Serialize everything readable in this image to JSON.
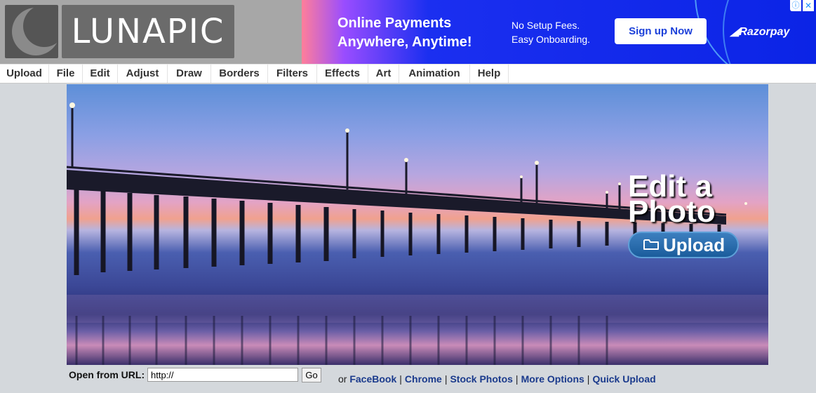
{
  "logo": {
    "text": "LUNAPIC"
  },
  "ad": {
    "headline_line1": "Online Payments",
    "headline_line2": "Anywhere, Anytime!",
    "sub_line1": "No Setup Fees.",
    "sub_line2": "Easy Onboarding.",
    "button": "Sign up Now",
    "brand": "Razorpay",
    "info_glyph": "ⓘ",
    "close_glyph": "✕"
  },
  "menu": [
    {
      "label": "Upload"
    },
    {
      "label": "File"
    },
    {
      "label": "Edit"
    },
    {
      "label": "Adjust"
    },
    {
      "label": "Draw"
    },
    {
      "label": "Borders"
    },
    {
      "label": "Filters"
    },
    {
      "label": "Effects"
    },
    {
      "label": "Art"
    },
    {
      "label": "Animation"
    },
    {
      "label": "Help"
    }
  ],
  "hero": {
    "title_line1": "Edit a",
    "title_line2": "Photo",
    "upload_label": "Upload",
    "upload_icon": "folder-icon"
  },
  "url": {
    "label": "Open from URL:",
    "value": "http://",
    "go": "Go"
  },
  "links": {
    "prefix": "or",
    "items": [
      "FaceBook",
      "Chrome",
      "Stock Photos",
      "More Options",
      "Quick Upload"
    ]
  }
}
